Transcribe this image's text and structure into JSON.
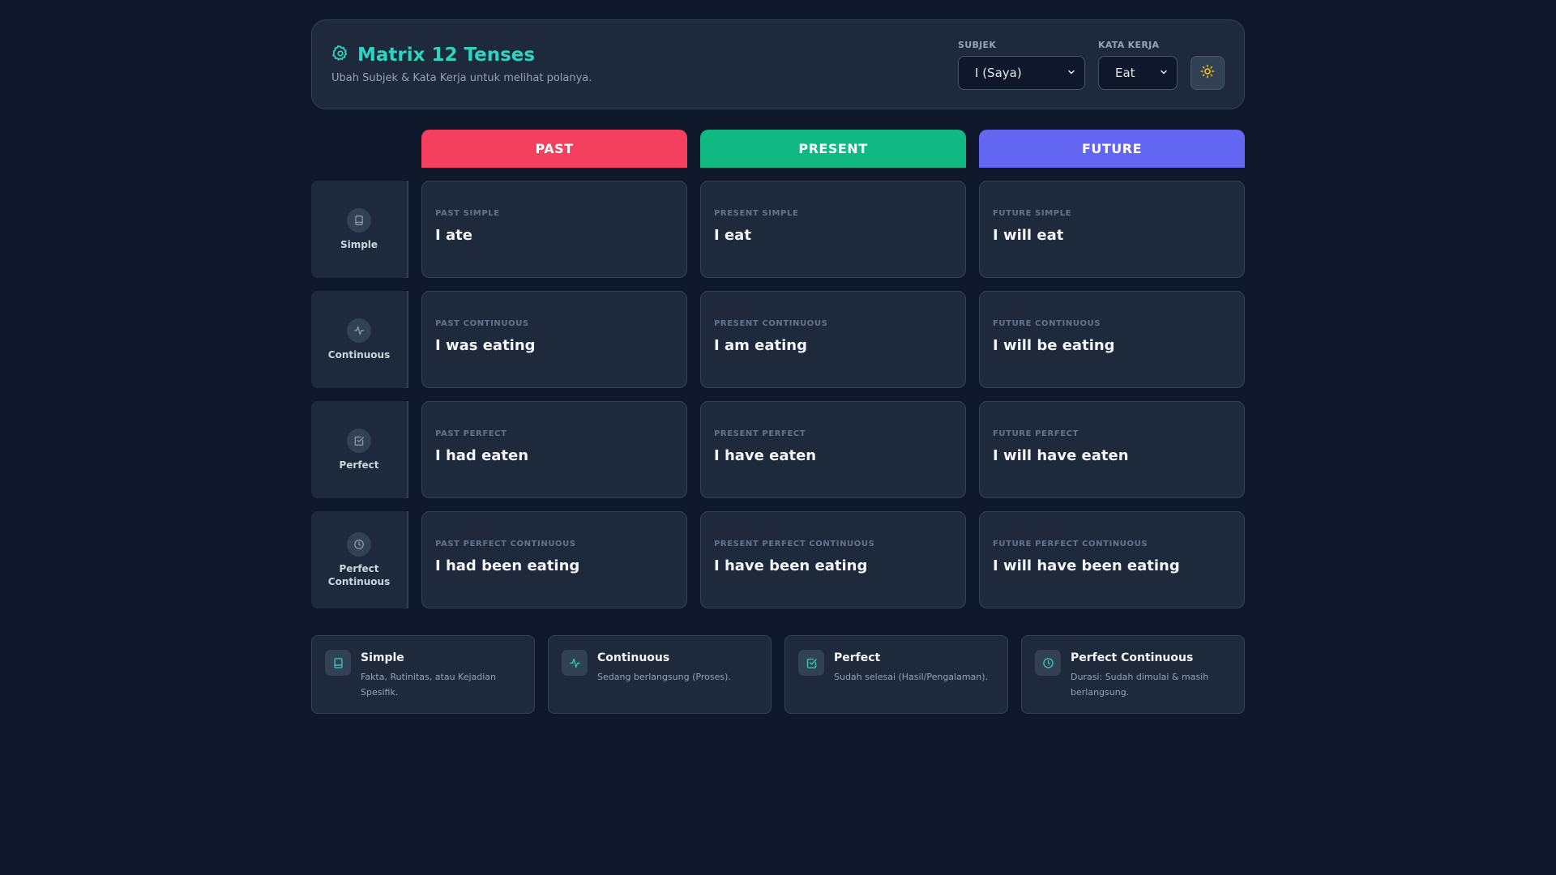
{
  "header": {
    "title": "Matrix 12 Tenses",
    "subtitle": "Ubah Subjek & Kata Kerja untuk melihat polanya.",
    "subject_label": "SUBJEK",
    "subject_value": "I (Saya)",
    "verb_label": "KATA KERJA",
    "verb_value": "Eat"
  },
  "columns": [
    {
      "label": "PAST",
      "color": "#f43f5e"
    },
    {
      "label": "PRESENT",
      "color": "#10b981"
    },
    {
      "label": "FUTURE",
      "color": "#6366f1"
    }
  ],
  "rows": [
    {
      "label": "Simple",
      "icon": "book-icon",
      "cells": [
        {
          "label": "PAST SIMPLE",
          "text": "I ate"
        },
        {
          "label": "PRESENT SIMPLE",
          "text": "I eat"
        },
        {
          "label": "FUTURE SIMPLE",
          "text": "I will eat"
        }
      ]
    },
    {
      "label": "Continuous",
      "icon": "activity-icon",
      "cells": [
        {
          "label": "PAST CONTINUOUS",
          "text": "I was eating"
        },
        {
          "label": "PRESENT CONTINUOUS",
          "text": "I am eating"
        },
        {
          "label": "FUTURE CONTINUOUS",
          "text": "I will be eating"
        }
      ]
    },
    {
      "label": "Perfect",
      "icon": "check-square-icon",
      "cells": [
        {
          "label": "PAST PERFECT",
          "text": "I had eaten"
        },
        {
          "label": "PRESENT PERFECT",
          "text": "I have eaten"
        },
        {
          "label": "FUTURE PERFECT",
          "text": "I will have eaten"
        }
      ]
    },
    {
      "label_line1": "Perfect",
      "label_line2": "Continuous",
      "icon": "clock-icon",
      "cells": [
        {
          "label": "PAST PERFECT CONTINUOUS",
          "text": "I had been eating"
        },
        {
          "label": "PRESENT PERFECT CONTINUOUS",
          "text": "I have been eating"
        },
        {
          "label": "FUTURE PERFECT CONTINUOUS",
          "text": "I will have been eating"
        }
      ]
    }
  ],
  "legend": [
    {
      "title": "Simple",
      "desc_line1": "Fakta, Rutinitas, atau Kejadian",
      "desc_line2": "Spesifik.",
      "icon": "book-icon"
    },
    {
      "title": "Continuous",
      "desc_line1": "Sedang berlangsung (Proses).",
      "desc_line2": "",
      "icon": "activity-icon"
    },
    {
      "title": "Perfect",
      "desc_line1": "Sudah selesai (Hasil/Pengalaman).",
      "desc_line2": "",
      "icon": "check-square-icon"
    },
    {
      "title": "Perfect Continuous",
      "desc_line1": "Durasi: Sudah dimulai & masih",
      "desc_line2": "berlangsung.",
      "icon": "clock-icon"
    }
  ],
  "colors": {
    "accent": "#2dd4bf",
    "background": "#0f172a",
    "card": "#1e293b",
    "sun": "#facc15"
  }
}
